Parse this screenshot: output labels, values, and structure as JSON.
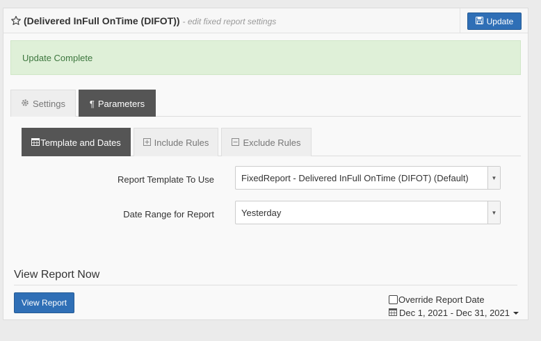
{
  "header": {
    "title": "(Delivered InFull OnTime (DIFOT))",
    "subtitle": "- edit fixed report settings",
    "update_label": "Update"
  },
  "alert": {
    "message": "Update Complete"
  },
  "main_tabs": [
    {
      "label": "Settings",
      "icon": "gear-icon",
      "active": false
    },
    {
      "label": "Parameters",
      "icon": "paragraph-icon",
      "active": true
    }
  ],
  "sub_tabs": [
    {
      "label": "Template and Dates",
      "icon": "calendar-icon",
      "active": true
    },
    {
      "label": "Include Rules",
      "icon": "plus-square-icon",
      "active": false
    },
    {
      "label": "Exclude Rules",
      "icon": "minus-square-icon",
      "active": false
    }
  ],
  "form": {
    "template_label": "Report Template To Use",
    "template_value": "FixedReport - Delivered InFull OnTime (DIFOT) (Default)",
    "date_label": "Date Range for Report",
    "date_value": "Yesterday"
  },
  "view_report": {
    "section_title": "View Report Now",
    "button_label": "View Report",
    "override_label": "Override Report Date",
    "override_checked": false,
    "date_range": "Dec 1, 2021 - Dec 31, 2021"
  },
  "colors": {
    "primary": "#2f6fb6",
    "success_bg": "#dff0d8",
    "success_text": "#3c763d",
    "active_tab": "#555555"
  }
}
